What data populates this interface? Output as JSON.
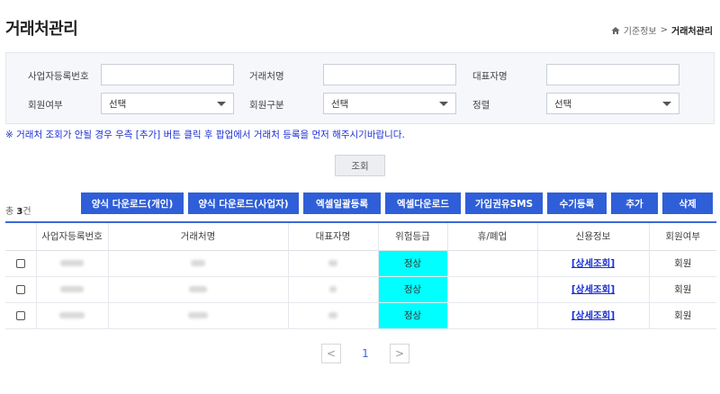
{
  "page": {
    "title": "거래처관리",
    "breadcrumb": {
      "parent": "기준정보",
      "current": "거래처관리",
      "separator": ">"
    }
  },
  "search": {
    "bizno_label": "사업자등록번호",
    "bizno_value": "",
    "name_label": "거래처명",
    "name_value": "",
    "ceo_label": "대표자명",
    "ceo_value": "",
    "member_label": "회원여부",
    "member_selected": "선택",
    "member_type_label": "회원구분",
    "member_type_selected": "선택",
    "sort_label": "정렬",
    "sort_selected": "선택",
    "button_label": "조회"
  },
  "notice": "※ 거래처 조회가 안될 경우 우측 [추가] 버튼 클릭 후 팝업에서 거래처 등록을 먼저 해주시기바랍니다.",
  "summary": {
    "prefix": "총 ",
    "count": "3",
    "suffix": "건"
  },
  "actions": {
    "download_personal": "양식 다운로드(개인)",
    "download_business": "양식 다운로드(사업자)",
    "excel_upload": "엑셀일괄등록",
    "excel_download": "엑셀다운로드",
    "sms": "가입권유SMS",
    "manual": "수기등록",
    "add": "추가",
    "delete": "삭제"
  },
  "table": {
    "headers": [
      "",
      "사업자등록번호",
      "거래처명",
      "대표자명",
      "위험등급",
      "휴/폐업",
      "신용정보",
      "회원여부"
    ],
    "rows": [
      {
        "risk": "정상",
        "closed": "",
        "credit": "[상세조회]",
        "member": "회원"
      },
      {
        "risk": "정상",
        "closed": "",
        "credit": "[상세조회]",
        "member": "회원"
      },
      {
        "risk": "정상",
        "closed": "",
        "credit": "[상세조회]",
        "member": "회원"
      }
    ]
  },
  "pagination": {
    "prev": "<",
    "current": "1",
    "next": ">"
  },
  "colors": {
    "primary": "#2f5fd8",
    "risk_normal": "#00ffff",
    "link": "#1a2fd4"
  }
}
